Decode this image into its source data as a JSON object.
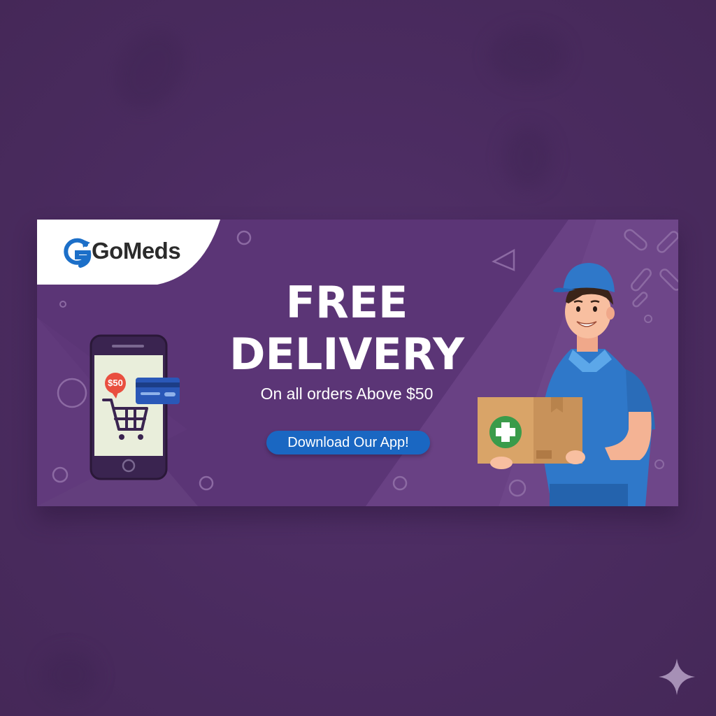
{
  "brand": {
    "name": "GoMeds",
    "logo_icon": "g-arrow-logo-icon",
    "accent": "#1a67c2"
  },
  "promo": {
    "headline_line1": "FREE",
    "headline_line2": "DELIVERY",
    "subline": "On all orders Above $50",
    "cta_label": "Download Our App!"
  },
  "phone": {
    "price_badge": "$50",
    "icons": [
      "cart-icon",
      "credit-card-icon"
    ]
  },
  "courier": {
    "package_icon": "medical-cross-icon"
  },
  "colors": {
    "background": "#4b2c60",
    "banner": "#5b3576",
    "cta": "#1a67c2",
    "badge": "#e94f3f",
    "cross": "#3a9b4a"
  }
}
